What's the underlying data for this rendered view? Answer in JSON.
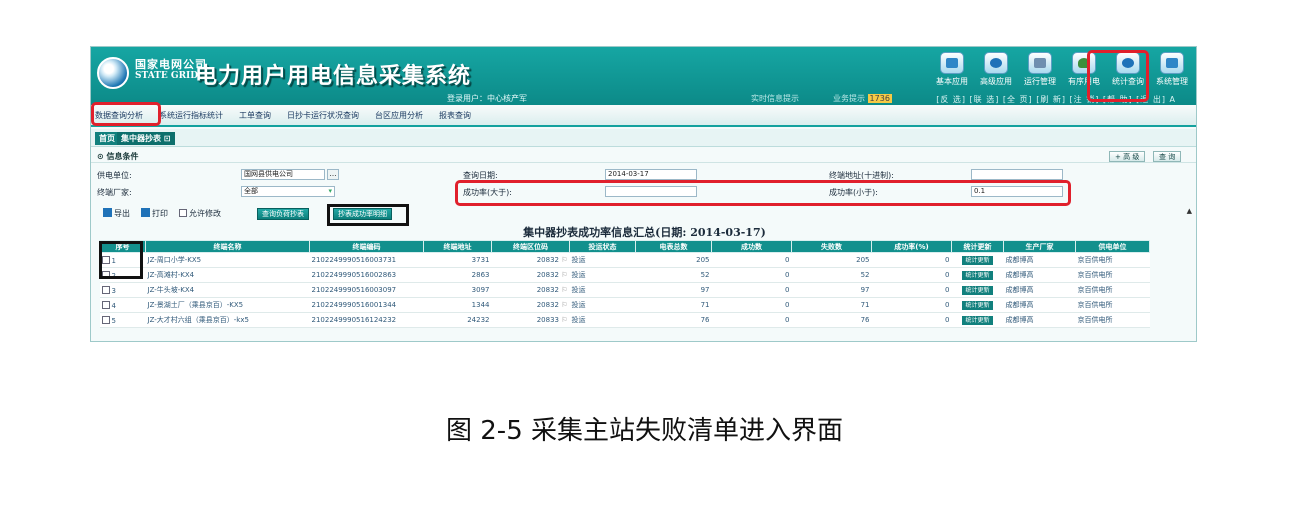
{
  "header": {
    "logo_cn": "国家电网公司",
    "logo_en": "STATE GRID",
    "title": "电力用户用电信息采集系统",
    "login": "登录用户：中心核产军",
    "hint1": "实时信息提示",
    "hint2": "业务提示",
    "hint2_badge": "1736",
    "tools": [
      {
        "label": "基本应用",
        "icon": "basic-app-icon"
      },
      {
        "label": "高级应用",
        "icon": "advanced-app-icon"
      },
      {
        "label": "运行管理",
        "icon": "run-manage-icon"
      },
      {
        "label": "有序用电",
        "icon": "ordered-power-icon"
      },
      {
        "label": "统计查询",
        "icon": "stats-query-icon"
      },
      {
        "label": "系统管理",
        "icon": "system-manage-icon"
      }
    ],
    "shortcuts": "[反 选] [联 选] [全 页] [刷 新] [注 销] [帮 助] [退 出] A"
  },
  "nav": {
    "items": [
      "数据查询分析",
      "系统运行指标统计",
      "工单查询",
      "日抄卡运行状况查询",
      "台区应用分析",
      "报表查询"
    ]
  },
  "subtabs": {
    "home": "首页",
    "current": "集中器抄表 ⊡"
  },
  "conditions": {
    "title": "⊙ 信息条件",
    "btn_advanced": "+ 高 级",
    "btn_query": "查 询",
    "supply_unit_label": "供电单位:",
    "supply_unit_value": "国网县供电公司",
    "date_label": "查询日期:",
    "date_value": "2014-03-17",
    "terminal_addr_label": "终端地址(十进制):",
    "vendor_label": "终端厂家:",
    "vendor_value": "全部",
    "rate_gt_label": "成功率(大于):",
    "rate_lt_label": "成功率(小于):",
    "rate_lt_value": "0.1"
  },
  "actions": {
    "export": "导出",
    "print": "打印",
    "allow_edit": "允许修改",
    "btn1": "查询负荷抄表",
    "btn2": "抄表成功率明细"
  },
  "table": {
    "title": "集中器抄表成功率信息汇总(日期: 2014-03-17)",
    "headers": [
      "序号",
      "终端名称",
      "终端编码",
      "终端地址",
      "终端区位码",
      "投运状态",
      "电表总数",
      "成功数",
      "失败数",
      "成功率(%)",
      "统计更新",
      "生产厂家",
      "供电单位"
    ],
    "rows": [
      {
        "no": "1",
        "name": "JZ-周口小学-KX5",
        "code": "2102249990516003731",
        "addr": "3731",
        "area": "20832",
        "status": "投运",
        "total": "205",
        "ok": "0",
        "fail": "205",
        "rate": "0",
        "update": "统计更新",
        "vendor": "成都博高",
        "unit": "京百供电所"
      },
      {
        "no": "2",
        "name": "JZ-高滩村-KX4",
        "code": "2102249990516002863",
        "addr": "2863",
        "area": "20832",
        "status": "投运",
        "total": "52",
        "ok": "0",
        "fail": "52",
        "rate": "0",
        "update": "统计更新",
        "vendor": "成都博高",
        "unit": "京百供电所"
      },
      {
        "no": "3",
        "name": "JZ-牛头坡-KX4",
        "code": "2102249990516003097",
        "addr": "3097",
        "area": "20832",
        "status": "投运",
        "total": "97",
        "ok": "0",
        "fail": "97",
        "rate": "0",
        "update": "统计更新",
        "vendor": "成都博高",
        "unit": "京百供电所"
      },
      {
        "no": "4",
        "name": "JZ-景湖土厂（乘县京百）-KX5",
        "code": "2102249990516001344",
        "addr": "1344",
        "area": "20832",
        "status": "投运",
        "total": "71",
        "ok": "0",
        "fail": "71",
        "rate": "0",
        "update": "统计更新",
        "vendor": "成都博高",
        "unit": "京百供电所"
      },
      {
        "no": "5",
        "name": "JZ-大才村六组（乘县京百）-kx5",
        "code": "2102249990516124232",
        "addr": "24232",
        "area": "20833",
        "status": "投运",
        "total": "76",
        "ok": "0",
        "fail": "76",
        "rate": "0",
        "update": "统计更新",
        "vendor": "成都博高",
        "unit": "京百供电所"
      }
    ]
  },
  "colors": {
    "header_teal": "#0c8a88",
    "highlight_red": "#e0202c",
    "highlight_black": "#111111"
  },
  "caption": "图 2-5  采集主站失败清单进入界面"
}
